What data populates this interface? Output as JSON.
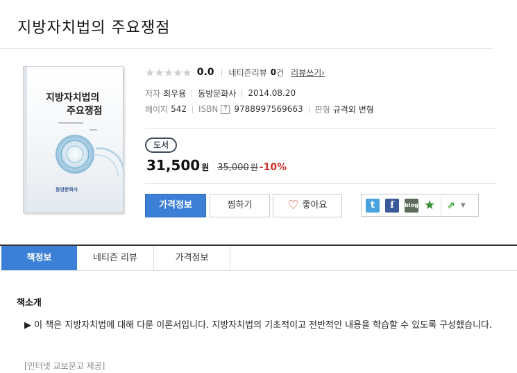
{
  "book": {
    "title": "지방자치법의 주요쟁점",
    "cover_line1": "지방자치법의",
    "cover_line2": "주요쟁점",
    "cover_publisher": "동방문화사"
  },
  "rating": {
    "stars": "★★★★★",
    "score": "0.0",
    "review_label": "네티즌리뷰",
    "review_count": "0",
    "review_unit": "건",
    "write_link": "리뷰쓰기›"
  },
  "info": {
    "author_label": "저자",
    "author": "최우용",
    "publisher": "동방문화사",
    "date": "2014.08.20",
    "pages_label": "페이지",
    "pages": "542",
    "isbn_label": "ISBN",
    "isbn_help": "?",
    "isbn": "9788997569663",
    "format_label": "판형",
    "format": "규격외 변형"
  },
  "price": {
    "badge": "도서",
    "sale": "31,500",
    "sale_unit": "원",
    "original": "35,000",
    "original_unit": "원",
    "discount": "-10%"
  },
  "buttons": {
    "price_info": "가격정보",
    "wish": "찜하기",
    "like_icon": "♡",
    "like": "좋아요"
  },
  "share": {
    "twitter": "t",
    "facebook": "f",
    "blog": "blog",
    "favorite": "★",
    "share": "⇗",
    "caret": "▼"
  },
  "tabs": [
    "책정보",
    "네티즌 리뷰",
    "가격정보"
  ],
  "section": {
    "title": "책소개",
    "intro": "▶ 이 책은 지방자치법에 대해 다룬 이론서입니다. 지방자치법의 기초적이고 전반적인 내용을 학습할 수 있도록 구성했습니다.",
    "source": "[인터넷 교보문고 제공]"
  },
  "colors": {
    "accent": "#3b7fd6",
    "discount": "#d0322b"
  }
}
